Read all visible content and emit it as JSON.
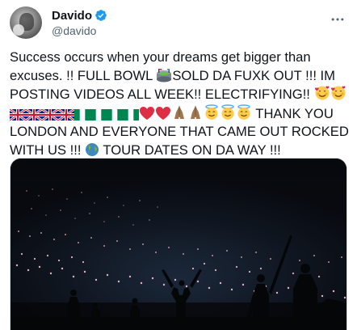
{
  "author": {
    "display_name": "Davido",
    "handle": "@davido",
    "verified": true,
    "avatar_icon": "avatar-photo"
  },
  "tweet": {
    "segments": [
      "Success occurs when your dreams get bigger than excuses. !! FULL BOWL ",
      "SOLD DA FUXK OUT !!! IM POSTING VIDEOS ALL WEEK!! ELECTRIFYING!! ",
      " THANK YOU LONDON AND EVERYONE THAT CAME OUT ROCKED WITH US !!! ",
      " TOUR DATES ON  DA WAY !!!"
    ],
    "emoji": {
      "stadium": "stadium-emoji",
      "smiling_hearts": "smiling-face-with-hearts-emoji",
      "uk_flag": "uk-flag-emoji",
      "nigeria_flag": "nigeria-flag-emoji",
      "red_heart": "red-heart-emoji",
      "folded_hands": "folded-hands-emoji",
      "halo_face": "smiling-face-with-halo-emoji",
      "globe": "globe-emoji"
    }
  },
  "media": {
    "description_icon": "concert-photo",
    "colors": {
      "background": "#0b0e14",
      "crowd_light": "#f1b8c8",
      "silhouette": "#050608"
    }
  },
  "colors": {
    "text": "#0f1419",
    "secondary": "#536471",
    "verified": "#1d9bf0",
    "border": "#cfd9de"
  }
}
